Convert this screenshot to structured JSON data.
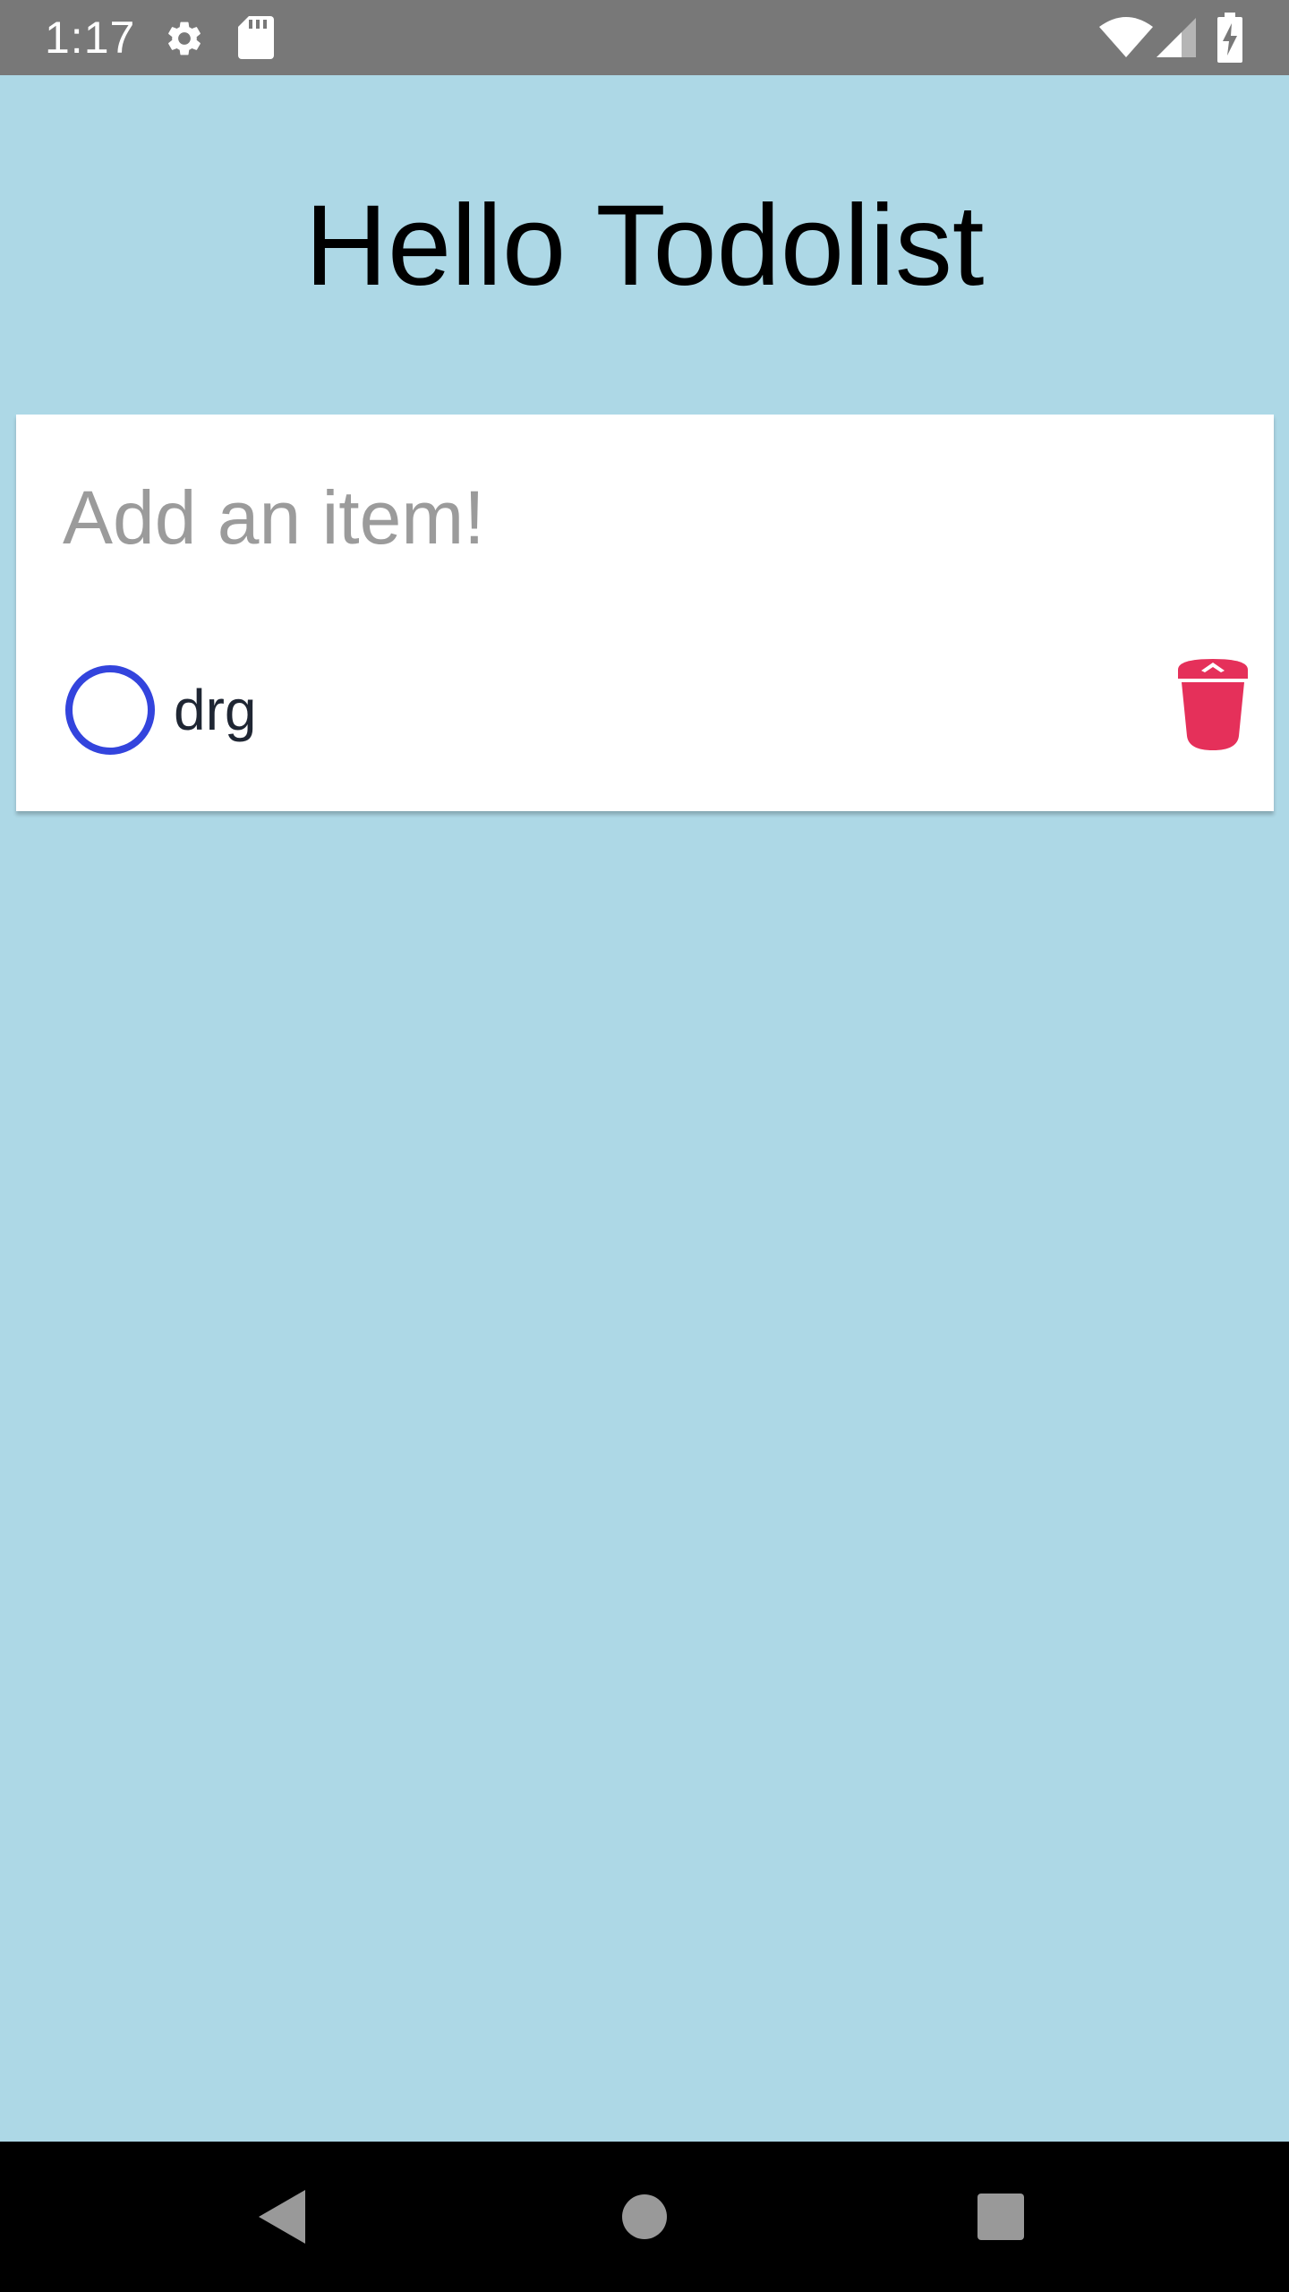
{
  "status_bar": {
    "time": "1:17",
    "icons": [
      "gear-icon",
      "sd-card-icon",
      "wifi-icon",
      "signal-icon",
      "battery-charging-icon"
    ]
  },
  "app": {
    "title": "Hello Todolist"
  },
  "input": {
    "placeholder": "Add an item!",
    "value": ""
  },
  "todos": [
    {
      "text": "drg",
      "completed": false,
      "check_icon": "circle-outline-icon",
      "delete_icon": "trash-icon"
    }
  ],
  "nav_bar": {
    "buttons": [
      "back-icon",
      "home-icon",
      "recents-icon"
    ]
  },
  "colors": {
    "background": "#add8e6",
    "status_bar": "#787878",
    "check_outline": "#3344dd",
    "delete": "#e5305a",
    "todo_text": "#1f2633",
    "placeholder": "#9b9b9b"
  }
}
